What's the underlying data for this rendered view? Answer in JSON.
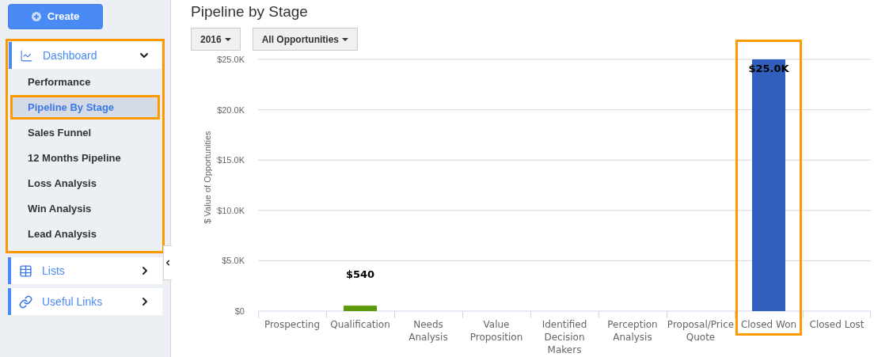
{
  "sidebar": {
    "create_button": "Create",
    "sections": [
      {
        "label": "Dashboard",
        "kind": "chart",
        "expanded": true,
        "highlighted": true,
        "items": [
          {
            "label": "Performance",
            "selected": false,
            "highlighted": false
          },
          {
            "label": "Pipeline By Stage",
            "selected": true,
            "highlighted": true
          },
          {
            "label": "Sales Funnel",
            "selected": false,
            "highlighted": false
          },
          {
            "label": "12 Months Pipeline",
            "selected": false,
            "highlighted": false
          },
          {
            "label": "Loss Analysis",
            "selected": false,
            "highlighted": false
          },
          {
            "label": "Win Analysis",
            "selected": false,
            "highlighted": false
          },
          {
            "label": "Lead Analysis",
            "selected": false,
            "highlighted": false
          }
        ]
      },
      {
        "label": "Lists",
        "kind": "table",
        "expanded": false,
        "highlighted": false
      },
      {
        "label": "Useful Links",
        "kind": "link",
        "expanded": false,
        "highlighted": false
      }
    ]
  },
  "page_title": "Pipeline by Stage",
  "filters": [
    {
      "label": "2016"
    },
    {
      "label": "All Opportunities"
    }
  ],
  "chart": {
    "chart_data": {
      "type": "bar",
      "ylabel": "$ Value of Opportunities",
      "categories": [
        "Prospecting",
        "Qualification",
        "Needs Analysis",
        "Value Proposition",
        "Identified Decision Makers",
        "Perception Analysis",
        "Proposal/Price Quote",
        "Closed Won",
        "Closed Lost"
      ],
      "series": [
        {
          "color": "#5b9a0a",
          "values": [
            null,
            540,
            null,
            null,
            null,
            null,
            null,
            null,
            null
          ]
        },
        {
          "color": "#315fbd",
          "values": [
            null,
            null,
            null,
            null,
            null,
            null,
            null,
            25000,
            null
          ]
        }
      ],
      "grid": true,
      "value_labels": [
        null,
        "$540",
        null,
        null,
        null,
        null,
        null,
        "$25.0K",
        null
      ],
      "ylim": [
        0,
        25000
      ],
      "yticks": [
        {
          "value": 0,
          "label": "$0"
        },
        {
          "value": 5000,
          "label": "$5.0K"
        },
        {
          "value": 10000,
          "label": "$10.0K"
        },
        {
          "value": 15000,
          "label": "$15.0K"
        },
        {
          "value": 20000,
          "label": "$20.0K"
        },
        {
          "value": 25000,
          "label": "$25.0K"
        }
      ]
    },
    "category_highlights": [
      false,
      false,
      false,
      false,
      false,
      false,
      false,
      true,
      false
    ]
  }
}
